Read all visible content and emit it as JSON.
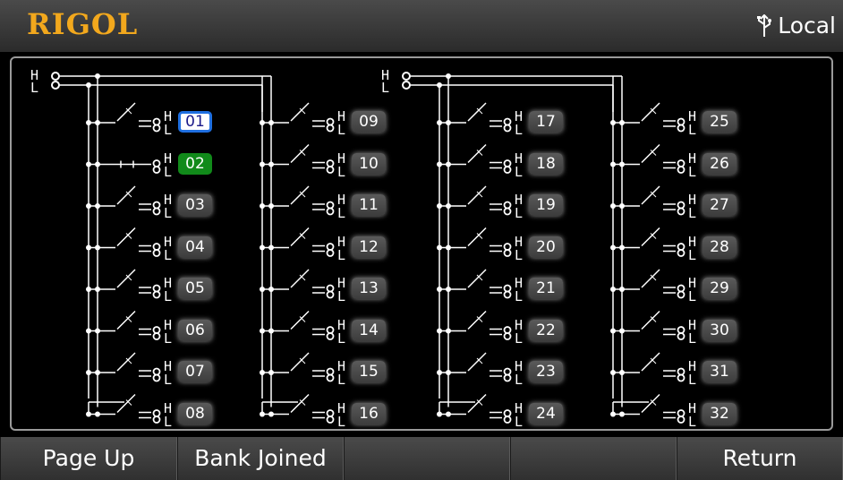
{
  "title_bar": {
    "brand": "RIGOL",
    "status_icon": "usb-icon",
    "status_text": "Local"
  },
  "switch_diagram": {
    "common_terminal_label": "H",
    "low_terminal_label": "L",
    "selected_channel": "01",
    "closed_channels": [
      "02"
    ],
    "banks": [
      {
        "columns": [
          [
            "01",
            "02",
            "03",
            "04",
            "05",
            "06",
            "07",
            "08"
          ],
          [
            "09",
            "10",
            "11",
            "12",
            "13",
            "14",
            "15",
            "16"
          ]
        ]
      },
      {
        "columns": [
          [
            "17",
            "18",
            "19",
            "20",
            "21",
            "22",
            "23",
            "24"
          ],
          [
            "25",
            "26",
            "27",
            "28",
            "29",
            "30",
            "31",
            "32"
          ]
        ]
      }
    ]
  },
  "softkeys": [
    {
      "label": "Page Up"
    },
    {
      "label": "Bank Joined"
    },
    {
      "label": ""
    },
    {
      "label": ""
    },
    {
      "label": "Return"
    }
  ],
  "colors": {
    "brand": "#f2a81d",
    "selected_border": "#1f6fe0",
    "closed_fill": "#118a1a"
  }
}
